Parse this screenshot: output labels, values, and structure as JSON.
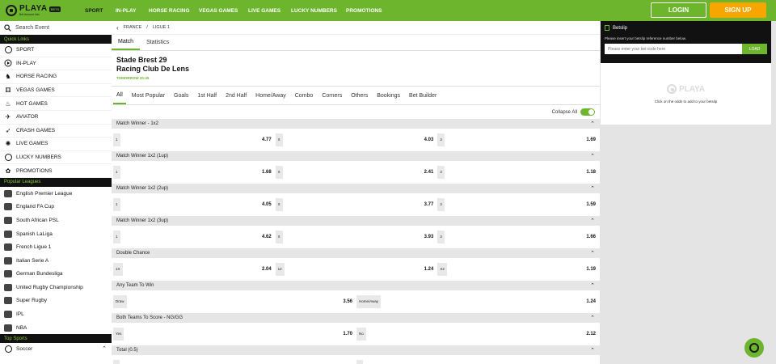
{
  "brand": {
    "name": "PLAYA",
    "badge": "BETS",
    "sub": "Bet Amount info"
  },
  "nav": [
    {
      "label": "SPORT",
      "active": true
    },
    {
      "label": "IN-PLAY"
    },
    {
      "label": "HORSE RACING"
    },
    {
      "label": "VEGAS GAMES"
    },
    {
      "label": "LIVE GAMES"
    },
    {
      "label": "LUCKY NUMBERS"
    },
    {
      "label": "PROMOTIONS"
    }
  ],
  "auth": {
    "login": "LOGIN",
    "signup": "SIGN UP"
  },
  "sidebar": {
    "search_placeholder": "Search Event",
    "quick_links_title": "Quick Links",
    "quick_links": [
      {
        "label": "SPORT",
        "icon": "soccer-ball-icon"
      },
      {
        "label": "IN-PLAY",
        "icon": "play-icon"
      },
      {
        "label": "HORSE RACING",
        "icon": "horse-icon"
      },
      {
        "label": "VEGAS GAMES",
        "icon": "dice-icon"
      },
      {
        "label": "HOT GAMES",
        "icon": "fire-icon"
      },
      {
        "label": "AVIATOR",
        "icon": "plane-icon"
      },
      {
        "label": "CRASH GAMES",
        "icon": "rocket-icon"
      },
      {
        "label": "LIVE GAMES",
        "icon": "live-icon"
      },
      {
        "label": "LUCKY NUMBERS",
        "icon": "lottery-icon"
      },
      {
        "label": "PROMOTIONS",
        "icon": "gift-icon"
      }
    ],
    "popular_title": "Popular Leagues",
    "popular_leagues": [
      {
        "label": "English Premier League"
      },
      {
        "label": "England FA Cup"
      },
      {
        "label": "South African PSL"
      },
      {
        "label": "Spanish LaLiga"
      },
      {
        "label": "French Ligue 1"
      },
      {
        "label": "Italian Serie A"
      },
      {
        "label": "German Bundesliga"
      },
      {
        "label": "United Rugby Championship"
      },
      {
        "label": "Super Rugby"
      },
      {
        "label": "IPL"
      },
      {
        "label": "NBA"
      }
    ],
    "top_sports_title": "Top Sports",
    "top_sports": [
      {
        "label": "Soccer"
      }
    ]
  },
  "main": {
    "breadcrumb": [
      "FRANCE",
      "LIGUE 1"
    ],
    "view_tabs": [
      {
        "label": "Match",
        "active": true
      },
      {
        "label": "Statistics"
      }
    ],
    "home_team": "Stade Brest 29",
    "away_team": "Racing Club De Lens",
    "kickoff": "TOMORROW 20:45",
    "market_tabs": [
      {
        "label": "All",
        "active": true
      },
      {
        "label": "Most Popular"
      },
      {
        "label": "Goals"
      },
      {
        "label": "1st Half"
      },
      {
        "label": "2nd Half"
      },
      {
        "label": "Home/Away"
      },
      {
        "label": "Combo"
      },
      {
        "label": "Corners"
      },
      {
        "label": "Others"
      },
      {
        "label": "Bookings"
      },
      {
        "label": "Bet Builder"
      }
    ],
    "collapse_all": "Collapse All",
    "markets": [
      {
        "title": "Match Winner - 1x2",
        "odds": [
          {
            "label": "1",
            "value": "4.77"
          },
          {
            "label": "X",
            "value": "4.03"
          },
          {
            "label": "2",
            "value": "1.69"
          }
        ]
      },
      {
        "title": "Match Winner 1x2 (1up)",
        "odds": [
          {
            "label": "1",
            "value": "1.68"
          },
          {
            "label": "X",
            "value": "2.41"
          },
          {
            "label": "2",
            "value": "1.18"
          }
        ]
      },
      {
        "title": "Match Winner 1x2 (2up)",
        "odds": [
          {
            "label": "1",
            "value": "4.05"
          },
          {
            "label": "X",
            "value": "3.77"
          },
          {
            "label": "2",
            "value": "1.59"
          }
        ]
      },
      {
        "title": "Match Winner 1x2 (3up)",
        "odds": [
          {
            "label": "1",
            "value": "4.62"
          },
          {
            "label": "X",
            "value": "3.93"
          },
          {
            "label": "2",
            "value": "1.66"
          }
        ]
      },
      {
        "title": "Double Chance",
        "odds": [
          {
            "label": "1X",
            "value": "2.04"
          },
          {
            "label": "12",
            "value": "1.24"
          },
          {
            "label": "X2",
            "value": "1.19"
          }
        ]
      },
      {
        "title": "Any Team To Win",
        "odds": [
          {
            "label": "Draw",
            "value": "3.56"
          },
          {
            "label": "Home/Away",
            "value": "1.24"
          }
        ]
      },
      {
        "title": "Both Teams To Score - NG/GG",
        "odds": [
          {
            "label": "Yes",
            "value": "1.70"
          },
          {
            "label": "No",
            "value": "2.12"
          }
        ]
      },
      {
        "title": "Total (0.5)",
        "odds": [
          {
            "label": "",
            "value": ""
          },
          {
            "label": "",
            "value": ""
          }
        ]
      }
    ]
  },
  "betslip": {
    "title": "Betslip",
    "description": "Please insert your betslip reference number below.",
    "input_placeholder": "Please enter your bet code here",
    "load_label": "LOAD",
    "empty_logo_text": "PLAYA",
    "empty_hint": "Click on the odds to add to your betslip"
  },
  "colors": {
    "brand_green": "#6cb52d",
    "signup_orange": "#f7a600",
    "dark": "#111111"
  }
}
